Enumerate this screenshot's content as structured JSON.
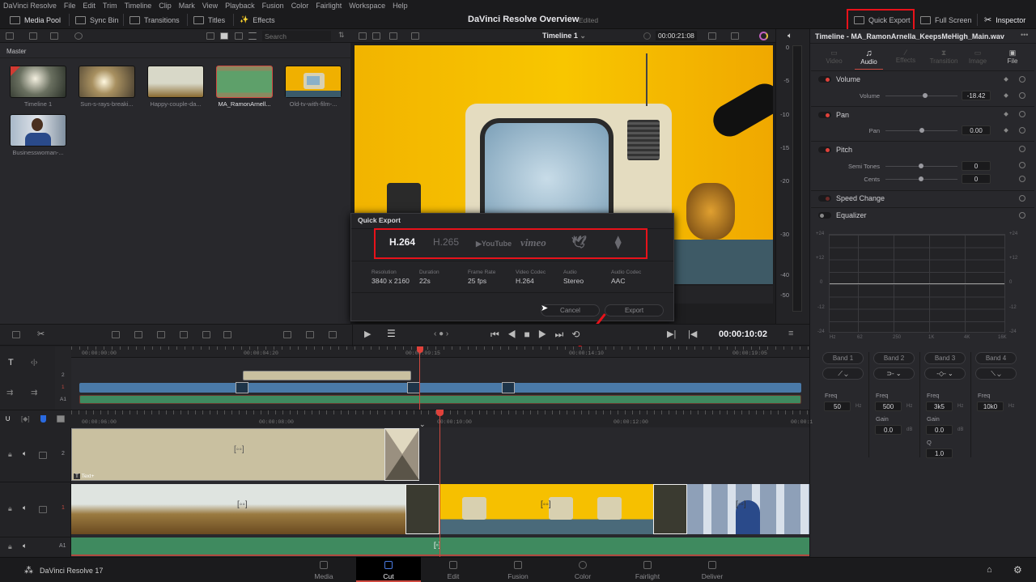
{
  "menu": [
    "DaVinci Resolve",
    "File",
    "Edit",
    "Trim",
    "Timeline",
    "Clip",
    "Mark",
    "View",
    "Playback",
    "Fusion",
    "Color",
    "Fairlight",
    "Workspace",
    "Help"
  ],
  "toolbar": {
    "media_pool": "Media Pool",
    "sync_bin": "Sync Bin",
    "transitions": "Transitions",
    "titles": "Titles",
    "effects": "Effects",
    "project_title": "DaVinci Resolve Overview",
    "project_status": "Edited",
    "quick_export": "Quick Export",
    "full_screen": "Full Screen",
    "inspector": "Inspector"
  },
  "media_pool": {
    "search_placeholder": "Search",
    "bin": "Master",
    "clips": [
      {
        "name": "Timeline 1"
      },
      {
        "name": "Sun-s-rays-breaki..."
      },
      {
        "name": "Happy-couple-da..."
      },
      {
        "name": "MA_RamonArnell..."
      },
      {
        "name": "Old-tv-with-film-..."
      },
      {
        "name": "Businesswoman-..."
      }
    ]
  },
  "viewer": {
    "timeline_name": "Timeline 1",
    "duration_tc": "00:00:21:08",
    "current_tc": "00:00:10:02"
  },
  "meter": {
    "scale": [
      "0",
      "-5",
      "-10",
      "-15",
      "-20",
      "-30",
      "-40",
      "-50"
    ]
  },
  "quick_export": {
    "title": "Quick Export",
    "presets": [
      "H.264",
      "H.265",
      "YouTube",
      "vimeo",
      "twitter",
      "dropbox"
    ],
    "specs": [
      {
        "k": "Resolution",
        "v": "3840 x 2160"
      },
      {
        "k": "Duration",
        "v": "22s"
      },
      {
        "k": "Frame Rate",
        "v": "25 fps"
      },
      {
        "k": "Video Codec",
        "v": "H.264"
      },
      {
        "k": "Audio",
        "v": "Stereo"
      },
      {
        "k": "Audio Codec",
        "v": "AAC"
      }
    ],
    "cancel": "Cancel",
    "export": "Export"
  },
  "inspector": {
    "title": "Timeline - MA_RamonArnella_KeepsMeHigh_Main.wav",
    "tabs": [
      "Video",
      "Audio",
      "Effects",
      "Transition",
      "Image",
      "File"
    ],
    "volume": {
      "header": "Volume",
      "label": "Volume",
      "value": "-18.42",
      "fraction": 0.55
    },
    "pan": {
      "header": "Pan",
      "label": "Pan",
      "value": "0.00",
      "fraction": 0.5
    },
    "pitch": {
      "header": "Pitch",
      "semi_label": "Semi Tones",
      "semi_value": "0",
      "cents_label": "Cents",
      "cents_value": "0"
    },
    "speed_change": "Speed Change",
    "equalizer": "Equalizer",
    "eq_y": [
      "+24",
      "+12",
      "0",
      "-12",
      "-24"
    ],
    "eq_x": [
      "Hz",
      "62",
      "250",
      "1K",
      "4K",
      "16K"
    ],
    "bands": [
      {
        "name": "Band 1",
        "freq": "50",
        "unit": "Hz"
      },
      {
        "name": "Band 2",
        "freq": "500",
        "unit": "Hz",
        "gain": "0.0",
        "gunit": "dB"
      },
      {
        "name": "Band 3",
        "freq": "3k5",
        "unit": "Hz",
        "gain": "0.0",
        "gunit": "dB",
        "q": "1.0"
      },
      {
        "name": "Band 4",
        "freq": "10k0",
        "unit": "Hz"
      }
    ],
    "freq_label": "Freq",
    "gain_label": "Gain",
    "q_label": "Q"
  },
  "timeline": {
    "upper_ticks": [
      "00:00:00:00",
      "00:00:04:20",
      "00:00:09:15",
      "00:00:14:10",
      "00:00:19:05"
    ],
    "lower_ticks": [
      "00:00:06:00",
      "00:00:08:00",
      "00:00:10:00",
      "00:00:12:00",
      "00:00:1"
    ],
    "tracks": [
      "2",
      "1",
      "A1"
    ],
    "text_clip": "Text+"
  },
  "pages": [
    "Media",
    "Cut",
    "Edit",
    "Fusion",
    "Color",
    "Fairlight",
    "Deliver"
  ],
  "app_name": "DaVinci Resolve 17",
  "colors": {
    "accent_red": "#e0413a",
    "highlight": "#e8121a",
    "video_track": "#4a7aa8",
    "audio_track": "#3f8a5f",
    "title_clip": "#c9c0a0"
  }
}
